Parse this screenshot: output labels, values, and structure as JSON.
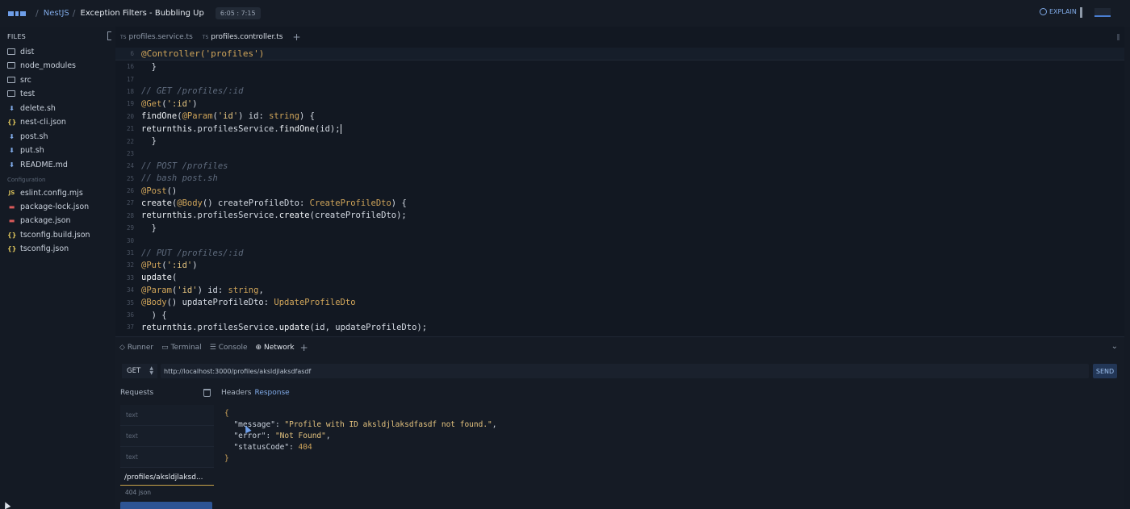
{
  "topbar": {
    "crumb_app": "NestJS",
    "crumb_title": "Exception Filters - Bubbling Up",
    "time": "6:05 : 7:15",
    "explain": "EXPLAIN"
  },
  "sidebar": {
    "title": "FILES",
    "items": [
      {
        "label": "dist",
        "icon": "folder-icon"
      },
      {
        "label": "node_modules",
        "icon": "folder-icon"
      },
      {
        "label": "src",
        "icon": "folder-icon"
      },
      {
        "label": "test",
        "icon": "folder-icon"
      },
      {
        "label": "delete.sh",
        "icon": "shell-icon"
      },
      {
        "label": "nest-cli.json",
        "icon": "json-icon"
      },
      {
        "label": "post.sh",
        "icon": "shell-icon"
      },
      {
        "label": "put.sh",
        "icon": "shell-icon"
      },
      {
        "label": "README.md",
        "icon": "markdown-icon"
      }
    ],
    "config_label": "Configuration",
    "config_items": [
      {
        "label": "eslint.config.mjs",
        "icon": "js-icon"
      },
      {
        "label": "package-lock.json",
        "icon": "npm-icon"
      },
      {
        "label": "package.json",
        "icon": "npm-icon"
      },
      {
        "label": "tsconfig.build.json",
        "icon": "json-icon"
      },
      {
        "label": "tsconfig.json",
        "icon": "json-icon"
      }
    ]
  },
  "editor": {
    "tabs": [
      {
        "label": "profiles.service.ts",
        "badge": "TS"
      },
      {
        "label": "profiles.controller.ts",
        "badge": "TS"
      }
    ],
    "sticky_line_no": "6",
    "sticky_code": "@Controller('profiles')",
    "line_numbers": [
      "16",
      "17",
      "18",
      "19",
      "20",
      "21",
      "22",
      "23",
      "24",
      "25",
      "26",
      "27",
      "28",
      "29",
      "30",
      "31",
      "32",
      "33",
      "34",
      "35",
      "36",
      "37"
    ]
  },
  "panel": {
    "tabs": [
      "Runner",
      "Terminal",
      "Console",
      "Network"
    ],
    "method": "GET",
    "url": "http://localhost:3000/profiles/aksldjlaksdfasdf",
    "send": "SEND",
    "requests_label": "Requests",
    "request_items": [
      "text",
      "text",
      "text"
    ],
    "active_request_path": "/profiles/aksldjlaksd...",
    "active_request_meta": "404 json",
    "resp_tab_headers": "Headers",
    "resp_tab_response": "Response",
    "response": {
      "message_key": "\"message\"",
      "message_val": "\"Profile with ID aksldjlaksdfasdf not found.\"",
      "error_key": "\"error\"",
      "error_val": "\"Not Found\"",
      "status_key": "\"statusCode\"",
      "status_val": "404"
    }
  }
}
